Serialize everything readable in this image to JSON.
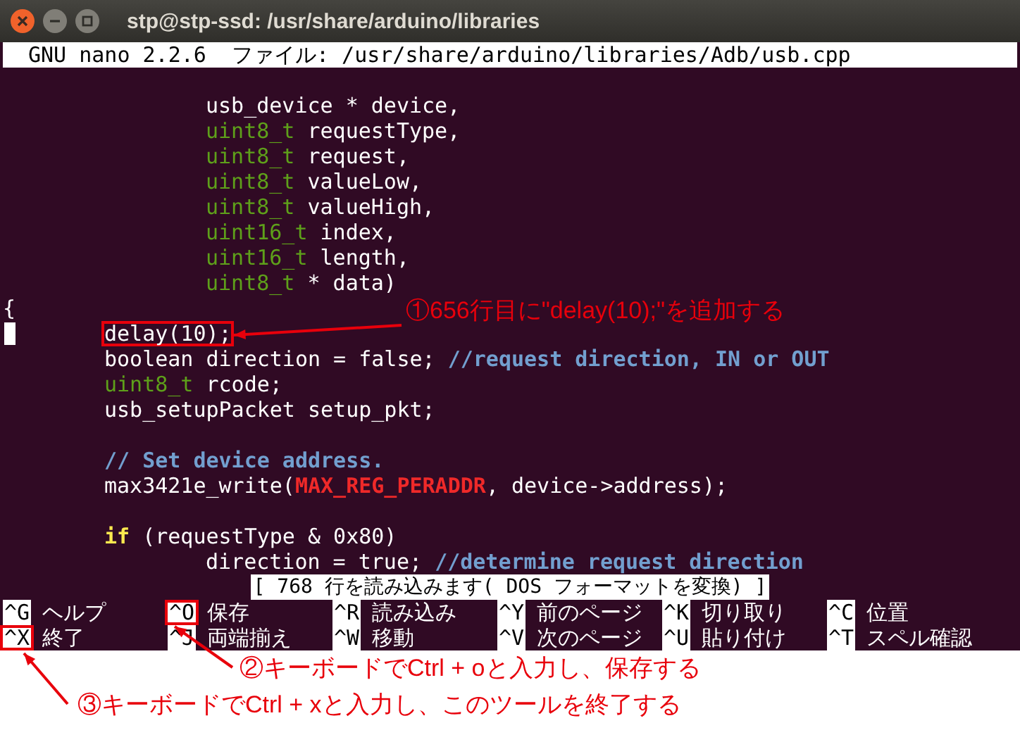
{
  "window": {
    "title": "stp@stp-ssd: /usr/share/arduino/libraries"
  },
  "editor": {
    "header": "GNU nano 2.2.6  ファイル: /usr/share/arduino/libraries/Adb/usb.cpp",
    "lines": [
      {
        "kind": "blank",
        "cursor": false,
        "boxed": false
      },
      {
        "kind": "param",
        "cursor": false,
        "boxed": false,
        "segments": [
          {
            "kind": "plain",
            "text": "usb_device * device,"
          }
        ]
      },
      {
        "kind": "param",
        "cursor": false,
        "boxed": false,
        "segments": [
          {
            "kind": "type",
            "text": "uint8_t"
          },
          {
            "kind": "plain",
            "text": " requestType,"
          }
        ]
      },
      {
        "kind": "param",
        "cursor": false,
        "boxed": false,
        "segments": [
          {
            "kind": "type",
            "text": "uint8_t"
          },
          {
            "kind": "plain",
            "text": " request,"
          }
        ]
      },
      {
        "kind": "param",
        "cursor": false,
        "boxed": false,
        "segments": [
          {
            "kind": "type",
            "text": "uint8_t"
          },
          {
            "kind": "plain",
            "text": " valueLow,"
          }
        ]
      },
      {
        "kind": "param",
        "cursor": false,
        "boxed": false,
        "segments": [
          {
            "kind": "type",
            "text": "uint8_t"
          },
          {
            "kind": "plain",
            "text": " valueHigh,"
          }
        ]
      },
      {
        "kind": "param",
        "cursor": false,
        "boxed": false,
        "segments": [
          {
            "kind": "type",
            "text": "uint16_t"
          },
          {
            "kind": "plain",
            "text": " index,"
          }
        ]
      },
      {
        "kind": "param",
        "cursor": false,
        "boxed": false,
        "segments": [
          {
            "kind": "type",
            "text": "uint16_t"
          },
          {
            "kind": "plain",
            "text": " length,"
          }
        ]
      },
      {
        "kind": "param",
        "cursor": false,
        "boxed": false,
        "segments": [
          {
            "kind": "type",
            "text": "uint8_t"
          },
          {
            "kind": "plain",
            "text": " * data)"
          }
        ]
      },
      {
        "kind": "brace",
        "cursor": false,
        "boxed": false,
        "segments": [
          {
            "kind": "plain",
            "text": "{"
          }
        ]
      },
      {
        "kind": "body",
        "cursor": true,
        "boxed": true,
        "segments": [
          {
            "kind": "plain",
            "text": "delay(10);"
          }
        ]
      },
      {
        "kind": "body",
        "cursor": false,
        "boxed": false,
        "segments": [
          {
            "kind": "plain",
            "text": "boolean direction = false; "
          },
          {
            "kind": "comment",
            "text": "//request direction, IN or OUT"
          }
        ]
      },
      {
        "kind": "body",
        "cursor": false,
        "boxed": false,
        "segments": [
          {
            "kind": "type",
            "text": "uint8_t"
          },
          {
            "kind": "plain",
            "text": " rcode;"
          }
        ]
      },
      {
        "kind": "body",
        "cursor": false,
        "boxed": false,
        "segments": [
          {
            "kind": "plain",
            "text": "usb_setupPacket setup_pkt;"
          }
        ]
      },
      {
        "kind": "blank",
        "cursor": false,
        "boxed": false
      },
      {
        "kind": "body",
        "cursor": false,
        "boxed": false,
        "segments": [
          {
            "kind": "comment",
            "text": "// Set device address."
          }
        ]
      },
      {
        "kind": "body",
        "cursor": false,
        "boxed": false,
        "segments": [
          {
            "kind": "plain",
            "text": "max3421e_write("
          },
          {
            "kind": "constant",
            "text": "MAX_REG_PERADDR"
          },
          {
            "kind": "plain",
            "text": ", device->address);"
          }
        ]
      },
      {
        "kind": "blank",
        "cursor": false,
        "boxed": false
      },
      {
        "kind": "body",
        "cursor": false,
        "boxed": false,
        "segments": [
          {
            "kind": "keyword",
            "text": "if"
          },
          {
            "kind": "plain",
            "text": " (requestType & 0x80)"
          }
        ]
      },
      {
        "kind": "nested",
        "cursor": false,
        "boxed": false,
        "segments": [
          {
            "kind": "plain",
            "text": "direction = true; "
          },
          {
            "kind": "comment",
            "text": "//determine request direction"
          }
        ]
      }
    ],
    "status": "[ 768 行を読み込みます( DOS フォーマットを変換) ]",
    "shortcuts": [
      [
        {
          "key": "^G",
          "label": "ヘルプ",
          "boxed": false
        },
        {
          "key": "^O",
          "label": "保存",
          "boxed": true
        },
        {
          "key": "^R",
          "label": "読み込み",
          "boxed": false
        },
        {
          "key": "^Y",
          "label": "前のページ",
          "boxed": false
        },
        {
          "key": "^K",
          "label": "切り取り",
          "boxed": false
        },
        {
          "key": "^C",
          "label": "位置",
          "boxed": false
        }
      ],
      [
        {
          "key": "^X",
          "label": "終了",
          "boxed": true
        },
        {
          "key": "^J",
          "label": "両端揃え",
          "boxed": false
        },
        {
          "key": "^W",
          "label": "移動",
          "boxed": false
        },
        {
          "key": "^V",
          "label": "次のページ",
          "boxed": false
        },
        {
          "key": "^U",
          "label": "貼り付け",
          "boxed": false
        },
        {
          "key": "^T",
          "label": "スペル確認",
          "boxed": false
        }
      ]
    ]
  },
  "callouts": [
    "①656行目に\"delay(10);\"を追加する",
    "②キーボードでCtrl + oと入力し、保存する",
    "③キーボードでCtrl + xと入力し、このツールを終了する"
  ]
}
